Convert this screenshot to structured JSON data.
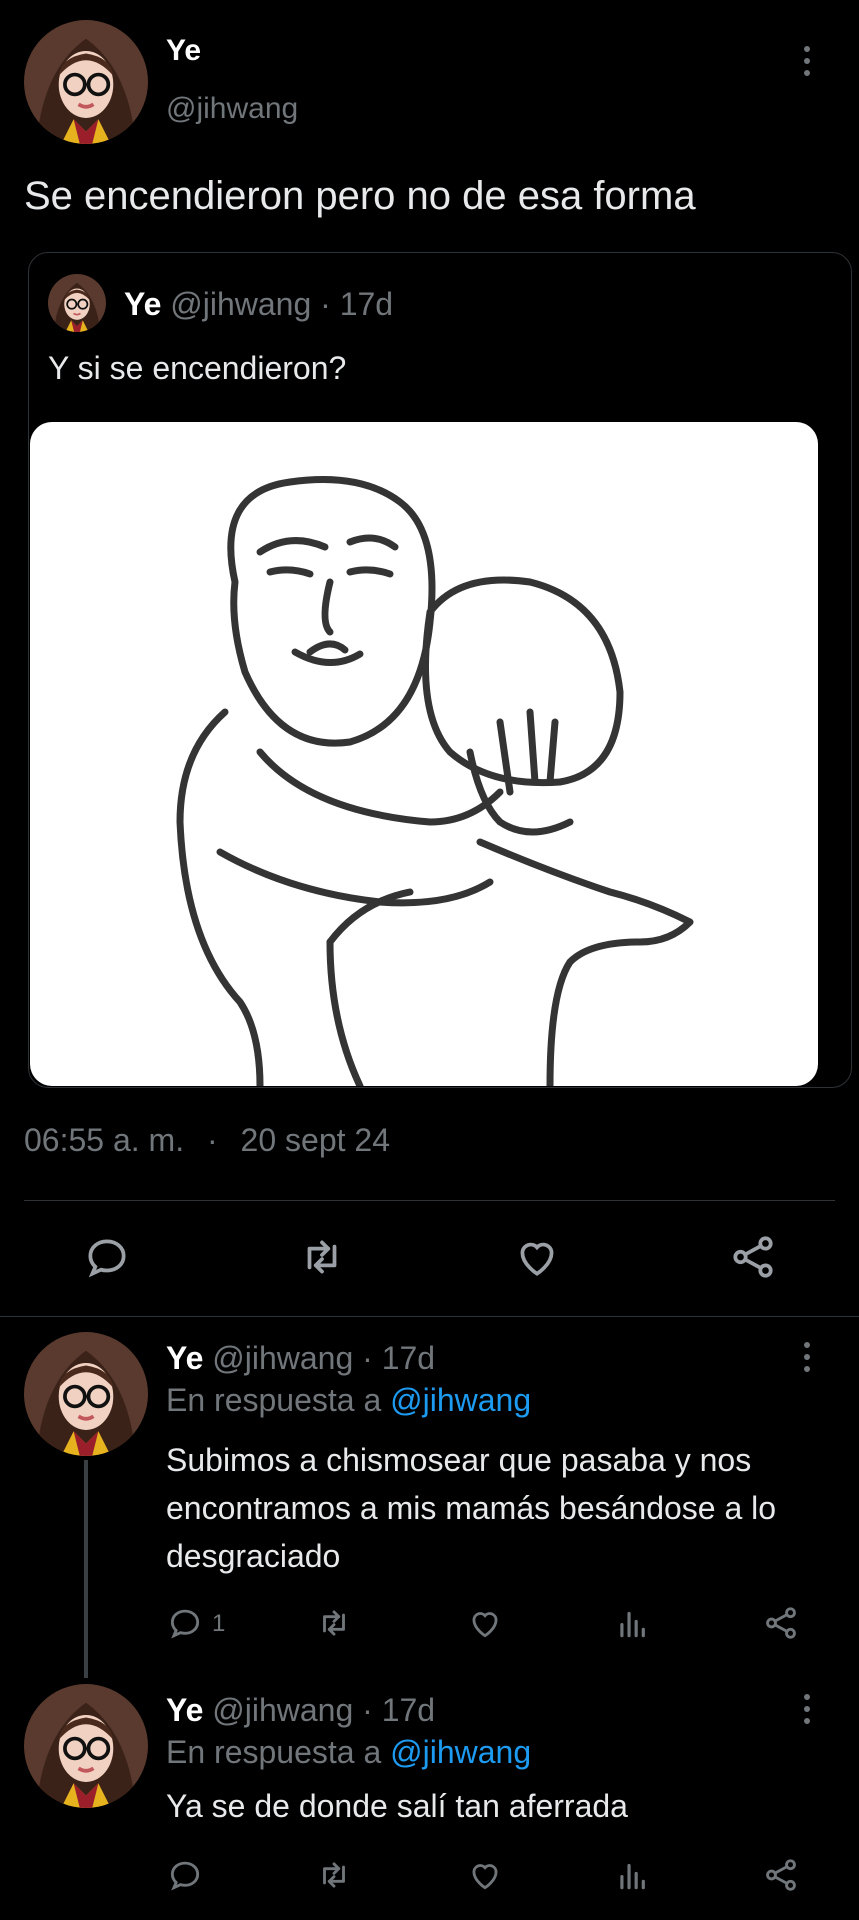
{
  "main_tweet": {
    "display_name": "Ye",
    "handle": "@jihwang",
    "text": "Se encendieron pero no de esa forma",
    "time": "06:55 a. m.",
    "separator": "·",
    "date": "20 sept 24"
  },
  "quoted_tweet": {
    "display_name": "Ye",
    "handle": "@jihwang",
    "age": "· 17d",
    "text": "Y si se encendieron?"
  },
  "replies": [
    {
      "display_name": "Ye",
      "handle": "@jihwang",
      "age": "· 17d",
      "reply_prefix": "En respuesta a",
      "reply_to": "@jihwang",
      "text_lines": [
        "Subimos a chismosear que pasaba y nos",
        "encontramos a mis mamás besándose a lo",
        "desgraciado"
      ],
      "reply_count": "1"
    },
    {
      "display_name": "Ye",
      "handle": "@jihwang",
      "age": "· 17d",
      "reply_prefix": "En respuesta a",
      "reply_to": "@jihwang",
      "text_lines": [
        "Ya se de donde salí tan aferrada"
      ],
      "reply_count": ""
    }
  ],
  "icons": {
    "reply": "reply-icon",
    "retweet": "retweet-icon",
    "like": "heart-icon",
    "views": "views-icon",
    "share": "share-icon",
    "more": "more-icon"
  },
  "colors": {
    "background": "#000000",
    "text": "#e7e9ea",
    "muted": "#71767b",
    "link": "#1d9bf0",
    "divider": "#2f3336"
  }
}
